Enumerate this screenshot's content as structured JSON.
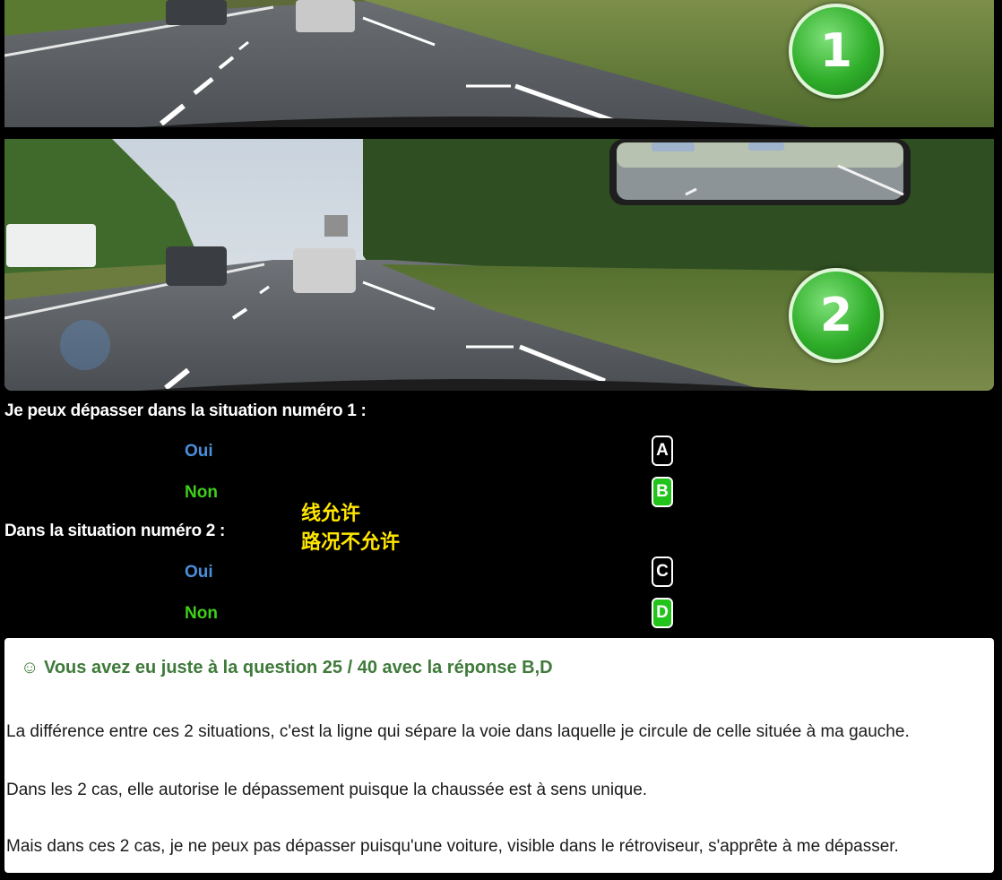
{
  "photos": [
    {
      "badge": "1"
    },
    {
      "badge": "2"
    }
  ],
  "questions": [
    {
      "text": "Je peux dépasser dans la situation numéro 1 :",
      "options": [
        {
          "label": "Oui",
          "key": "A",
          "selected": false
        },
        {
          "label": "Non",
          "key": "B",
          "selected": true
        }
      ]
    },
    {
      "text": "Dans la situation numéro 2 :",
      "options": [
        {
          "label": "Oui",
          "key": "C",
          "selected": false
        },
        {
          "label": "Non",
          "key": "D",
          "selected": true
        }
      ]
    }
  ],
  "annotation": {
    "line1": "线允许",
    "line2": "路况不允许"
  },
  "result": {
    "title": "☺ Vous avez eu juste à la question 25 / 40 avec la réponse B,D",
    "paragraphs": [
      "La différence entre ces 2 situations, c'est la ligne qui sépare la voie dans laquelle je circule de celle située à ma gauche.",
      "Dans les 2 cas, elle autorise le dépassement puisque la chaussée est à sens unique.",
      "Mais dans ces 2 cas, je ne peux pas dépasser puisqu'une voiture, visible dans le rétroviseur, s'apprête à me dépasser."
    ]
  },
  "colors": {
    "correct_green": "#22c31a",
    "oui_blue": "#4a8fdc",
    "non_green": "#3ecf1c",
    "annotation_yellow": "#ffe600"
  }
}
